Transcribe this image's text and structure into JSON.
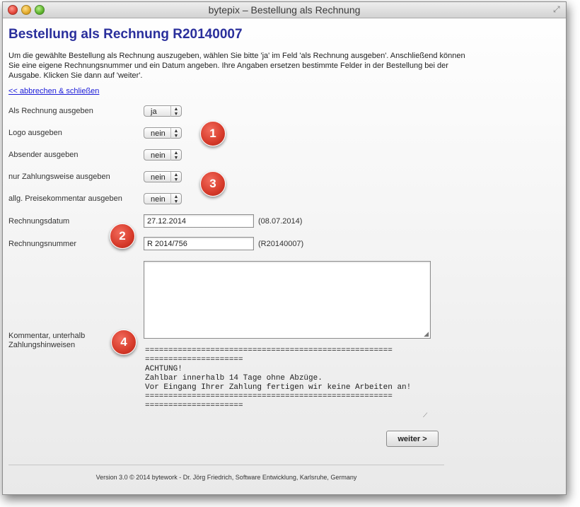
{
  "window": {
    "title": "bytepix – Bestellung als Rechnung"
  },
  "page": {
    "heading": "Bestellung als Rechnung R20140007",
    "intro": "Um die gewählte Bestellung als Rechnung auszugeben, wählen Sie bitte 'ja' im Feld 'als Rechnung ausgeben'. Anschließend können Sie eine eigene Rechnungsnummer und ein Datum angeben. Ihre Angaben ersetzen bestimmte Felder in der Bestellung bei der Ausgabe. Klicken Sie dann auf 'weiter'.",
    "cancel_link": "<< abbrechen & schließen"
  },
  "form": {
    "as_invoice": {
      "label": "Als Rechnung ausgeben",
      "value": "ja"
    },
    "logo": {
      "label": "Logo ausgeben",
      "value": "nein"
    },
    "sender": {
      "label": "Absender ausgeben",
      "value": "nein"
    },
    "payment_only": {
      "label": "nur Zahlungsweise ausgeben",
      "value": "nein"
    },
    "price_comment": {
      "label": "allg. Preisekommentar ausgeben",
      "value": "nein"
    },
    "invoice_date": {
      "label": "Rechnungsdatum",
      "value": "27.12.2014",
      "original": "(08.07.2014)"
    },
    "invoice_number": {
      "label": "Rechnungsnummer",
      "value": "R 2014/756",
      "original": "(R20140007)"
    },
    "comment": {
      "label_line1": "Kommentar, unterhalb",
      "label_line2": "Zahlungshinweisen",
      "value": "",
      "default_text": "=====================================================\n=====================\nACHTUNG!\nZahlbar innerhalb 14 Tage ohne Abzüge.\nVor Eingang Ihrer Zahlung fertigen wir keine Arbeiten an!\n=====================================================\n====================="
    },
    "submit_label": "weiter >"
  },
  "badges": [
    "1",
    "2",
    "3",
    "4"
  ],
  "footer": "Version 3.0 © 2014 bytework - Dr. Jörg Friedrich, Software Entwicklung, Karlsruhe, Germany",
  "colors": {
    "heading": "#2a2f9c",
    "link": "#1a1ad8",
    "badge": "#d63a2a"
  }
}
